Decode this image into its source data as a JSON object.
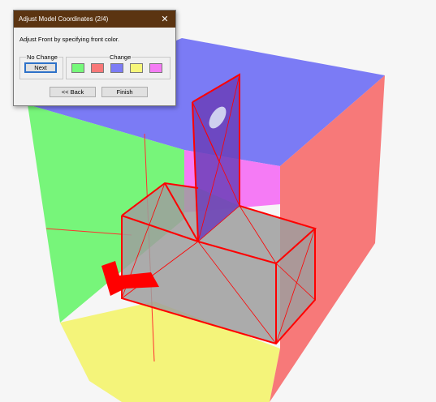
{
  "dialog": {
    "title": "Adjust Model Coordinates (2/4)",
    "close_glyph": "✕",
    "instruction": "Adjust Front by specifying front color.",
    "no_change_label": "No Change",
    "next_label": "Next",
    "change_label": "Change",
    "swatches": [
      {
        "name": "green",
        "color": "#76f97a"
      },
      {
        "name": "red",
        "color": "#f87878"
      },
      {
        "name": "blue",
        "color": "#7c7cf5"
      },
      {
        "name": "yellow",
        "color": "#f7f77a"
      },
      {
        "name": "magenta",
        "color": "#f47cf4"
      }
    ],
    "back_label": "<< Back",
    "finish_label": "Finish"
  },
  "model": {
    "face_colors": {
      "top": "#7b7bf5",
      "left": "#77f57a",
      "right": "#f77979",
      "bottom": "#f4f47a",
      "back_magenta": "#f57bf5",
      "edge": "#ff0000",
      "part_fill": "#9e9e9e"
    }
  }
}
